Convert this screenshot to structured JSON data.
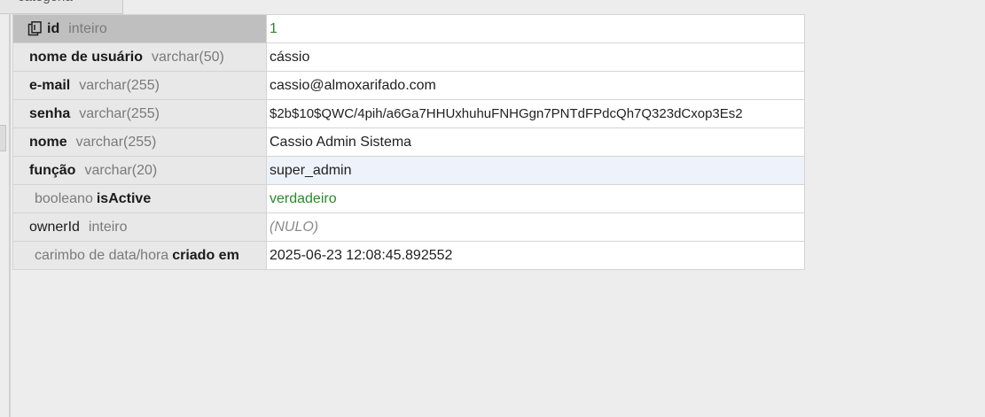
{
  "top_tab": {
    "label": "categoria"
  },
  "icons": {
    "primary_key": "primary-key-icon"
  },
  "colors": {
    "boolean_value": "#2a8a2a",
    "null_value": "#8a8a8a",
    "selected_row": "#eef3fb"
  },
  "fields": [
    {
      "name": "id",
      "type": "inteiro",
      "value": "1"
    },
    {
      "name": "nome de usuário",
      "type": "varchar(50)",
      "value": "cássio"
    },
    {
      "name": "e-mail",
      "type": "varchar(255)",
      "value": "cassio@almoxarifado.com"
    },
    {
      "name": "senha",
      "type": "varchar(255)",
      "value": "$2b$10$QWC/4pih/a6Ga7HHUxhuhuFNHGgn7PNTdFPdcQh7Q323dCxop3Es2"
    },
    {
      "name": "nome",
      "type": "varchar(255)",
      "value": "Cassio Admin Sistema"
    },
    {
      "name": "função",
      "type": "varchar(20)",
      "value": "super_admin"
    },
    {
      "name": "isActive",
      "type": "booleano",
      "value": "verdadeiro"
    },
    {
      "name": "ownerId",
      "type": "inteiro",
      "value": "(NULO)"
    },
    {
      "name": "criado em",
      "type": "carimbo de data/hora",
      "value": "2025-06-23 12:08:45.892552"
    }
  ]
}
